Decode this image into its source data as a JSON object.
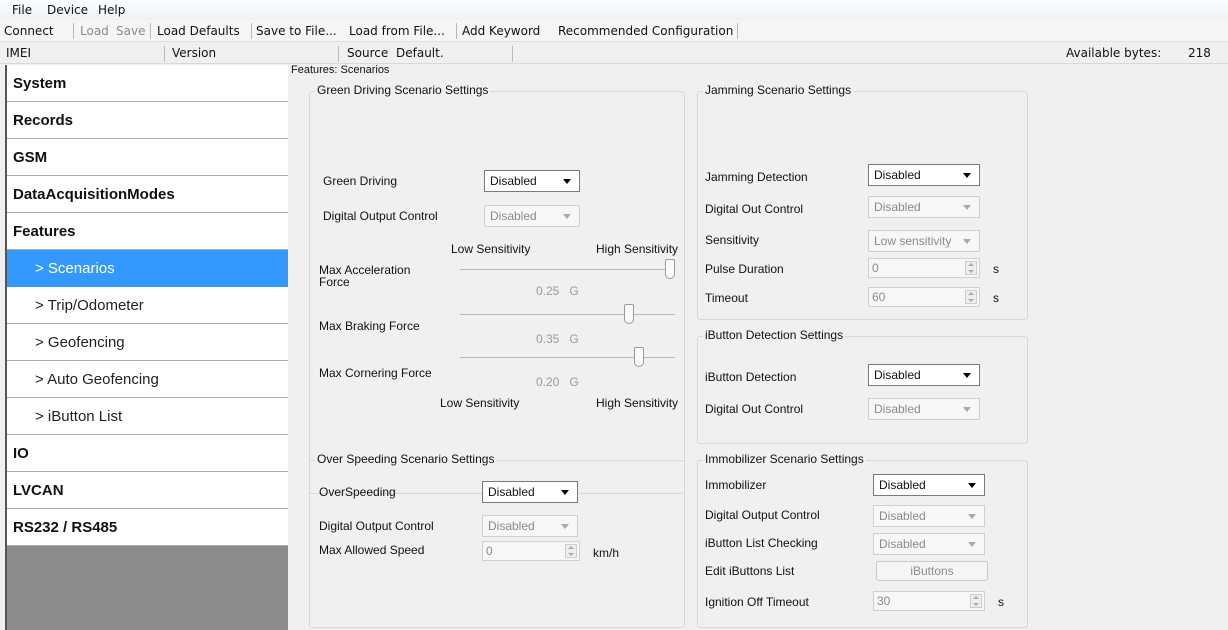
{
  "menubar": {
    "file": "File",
    "device": "Device",
    "help": "Help"
  },
  "toolbar": {
    "connect": "Connect",
    "load": "Load",
    "save": "Save",
    "load_defaults": "Load Defaults",
    "save_to_file": "Save to File...",
    "load_from_file": "Load from File...",
    "add_keyword": "Add Keyword",
    "recommended": "Recommended Configuration"
  },
  "infobar": {
    "imei": "IMEI",
    "version": "Version",
    "source": "Source",
    "source_value": "Default.",
    "available_label": "Available bytes:",
    "available_value": "218"
  },
  "sidebar": {
    "items": [
      {
        "label": "System"
      },
      {
        "label": "Records"
      },
      {
        "label": "GSM"
      },
      {
        "label": "DataAcquisitionModes"
      },
      {
        "label": "Features"
      },
      {
        "label": "> Scenarios"
      },
      {
        "label": "> Trip/Odometer"
      },
      {
        "label": "> Geofencing"
      },
      {
        "label": "> Auto Geofencing"
      },
      {
        "label": "> iButton List"
      },
      {
        "label": "IO"
      },
      {
        "label": "LVCAN"
      },
      {
        "label": "RS232 / RS485"
      }
    ]
  },
  "main": {
    "title": "Features: Scenarios",
    "green": {
      "title": "Green Driving Scenario Settings",
      "green_driving_label": "Green Driving",
      "green_driving_value": "Disabled",
      "digital_output_label": "Digital Output Control",
      "digital_output_value": "Disabled",
      "low_sens": "Low Sensitivity",
      "high_sens": "High Sensitivity",
      "max_accel_label": "Max Acceleration Force",
      "max_accel_value": "0.25",
      "max_brake_label": "Max Braking Force",
      "max_brake_value": "0.35",
      "max_corner_label": "Max Cornering Force",
      "max_corner_value": "0.20",
      "unit": "G",
      "low_sens2": "Low Sensitivity",
      "high_sens2": "High Sensitivity"
    },
    "over": {
      "title": "Over Speeding Scenario Settings",
      "overspeeding_label": "OverSpeeding",
      "overspeeding_value": "Disabled",
      "digital_output_label": "Digital Output Control",
      "digital_output_value": "Disabled",
      "max_speed_label": "Max Allowed Speed",
      "max_speed_value": "0",
      "max_speed_unit": "km/h"
    },
    "jamming": {
      "title": "Jamming Scenario Settings",
      "detection_label": "Jamming Detection",
      "detection_value": "Disabled",
      "digital_out_label": "Digital Out Control",
      "digital_out_value": "Disabled",
      "sensitivity_label": "Sensitivity",
      "sensitivity_value": "Low sensitivity",
      "pulse_label": "Pulse Duration",
      "pulse_value": "0",
      "timeout_label": "Timeout",
      "timeout_value": "60",
      "unit_s": "s"
    },
    "ibutton": {
      "title": "iButton Detection Settings",
      "detection_label": "iButton Detection",
      "detection_value": "Disabled",
      "digital_out_label": "Digital Out Control",
      "digital_out_value": "Disabled"
    },
    "immo": {
      "title": "Immobilizer Scenario Settings",
      "immobilizer_label": "Immobilizer",
      "immobilizer_value": "Disabled",
      "digital_output_label": "Digital Output Control",
      "digital_output_value": "Disabled",
      "list_check_label": "iButton List Checking",
      "list_check_value": "Disabled",
      "edit_list_label": "Edit iButtons List",
      "edit_list_button": "iButtons",
      "ign_timeout_label": "Ignition Off Timeout",
      "ign_timeout_value": "30",
      "unit_s": "s"
    },
    "sliders": {
      "accel_level": 1.0,
      "brake_level": 0.8,
      "corner_level": 0.85
    }
  }
}
